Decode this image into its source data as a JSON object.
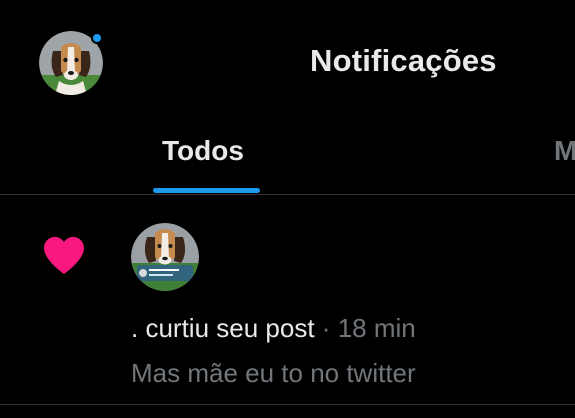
{
  "header": {
    "title": "Notificações",
    "avatar_status_color": "#1d9bf0",
    "avatar_icon": "beagle-puppy-avatar"
  },
  "tabs": [
    {
      "label": "Todos",
      "selected": true
    },
    {
      "label": "Menções",
      "selected": false
    }
  ],
  "accent_color": "#1d9bf0",
  "notifications": [
    {
      "icon": "heart-icon",
      "icon_color": "#f91880",
      "user": ".",
      "action": "curtiu seu post",
      "separator": "·",
      "time": "18 min",
      "preview": "Mas mãe eu to no twitter"
    }
  ]
}
